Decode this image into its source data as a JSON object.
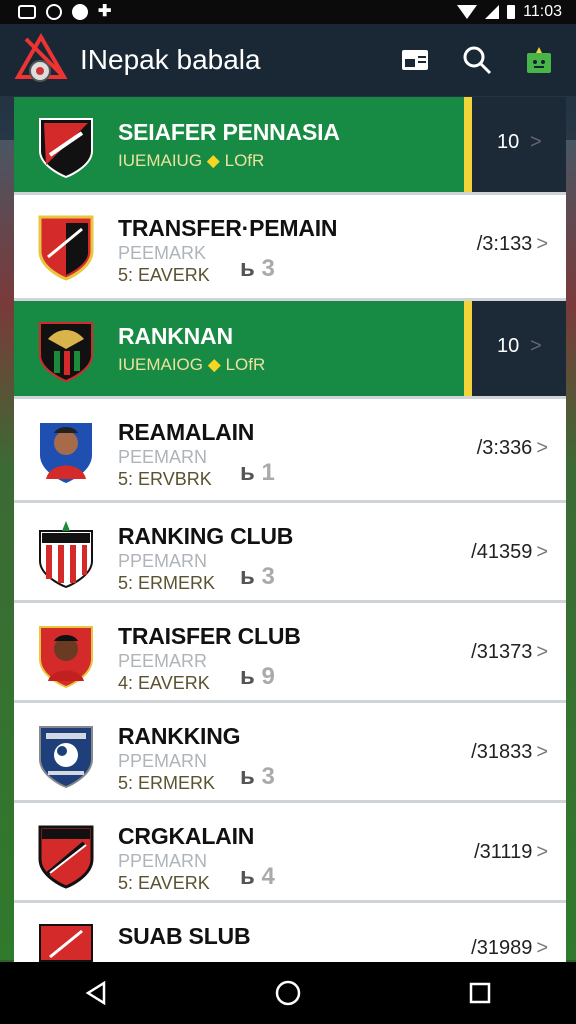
{
  "status_bar": {
    "time": "11:03",
    "icons": [
      "gallery-icon",
      "circle-icon",
      "dot-icon",
      "plus-icon",
      "wifi-icon",
      "signal-icon",
      "battery-icon"
    ]
  },
  "app_bar": {
    "title": "INepak babala",
    "actions": [
      "card-icon",
      "search-icon",
      "gift-icon"
    ]
  },
  "colors": {
    "green": "#178a43",
    "dark": "#1b2a36",
    "accent": "#f1d43a"
  },
  "rows": [
    {
      "type": "green",
      "title": "SEIAFER PENNASIA",
      "subtitle": "IUEMAIUG",
      "tag": "LOfR",
      "value": "10",
      "chevron": ">"
    },
    {
      "type": "white",
      "title": "TRANSFER·PEMAIN",
      "sub1": "PEEMARK",
      "sub2": "5: EAVERK",
      "rank_prefix": "ь",
      "rank_num": "3",
      "score": "/3:133",
      "chevron": ">"
    },
    {
      "type": "green",
      "title": "RANKNAN",
      "subtitle": "IUEMAIOG",
      "tag": "LOfR",
      "value": "10",
      "chevron": ">"
    },
    {
      "type": "white",
      "title": "REAMALAIN",
      "sub1": "PEEMARN",
      "sub2": "5: ERVBRK",
      "rank_prefix": "ь",
      "rank_num": "1",
      "score": "/3:336",
      "chevron": ">"
    },
    {
      "type": "white",
      "title": "RANKING CLUB",
      "sub1": "PPEMARN",
      "sub2": "5: ERMERK",
      "rank_prefix": "ь",
      "rank_num": "3",
      "score": "/41359",
      "chevron": ">"
    },
    {
      "type": "white",
      "title": "TRAISFER CLUB",
      "sub1": "PEEMARR",
      "sub2": "4: EAVERK",
      "rank_prefix": "ь",
      "rank_num": "9",
      "score": "/31373",
      "chevron": ">"
    },
    {
      "type": "white",
      "title": "RANKKING",
      "sub1": "PPEMARN",
      "sub2": "5: ERMERK",
      "rank_prefix": "ь",
      "rank_num": "3",
      "score": "/31833",
      "chevron": ">"
    },
    {
      "type": "white",
      "title": "CRGKALAIN",
      "sub1": "PPEMARN",
      "sub2": "5: EAVERK",
      "rank_prefix": "ь",
      "rank_num": "4",
      "score": "/31119",
      "chevron": ">"
    },
    {
      "type": "white",
      "title": "SUAB SLUB",
      "sub1": "",
      "sub2": "",
      "rank_prefix": "",
      "rank_num": "",
      "score": "/31989",
      "chevron": ">"
    }
  ],
  "nav_bar": {
    "buttons": [
      "back-icon",
      "home-icon",
      "recents-icon"
    ]
  }
}
